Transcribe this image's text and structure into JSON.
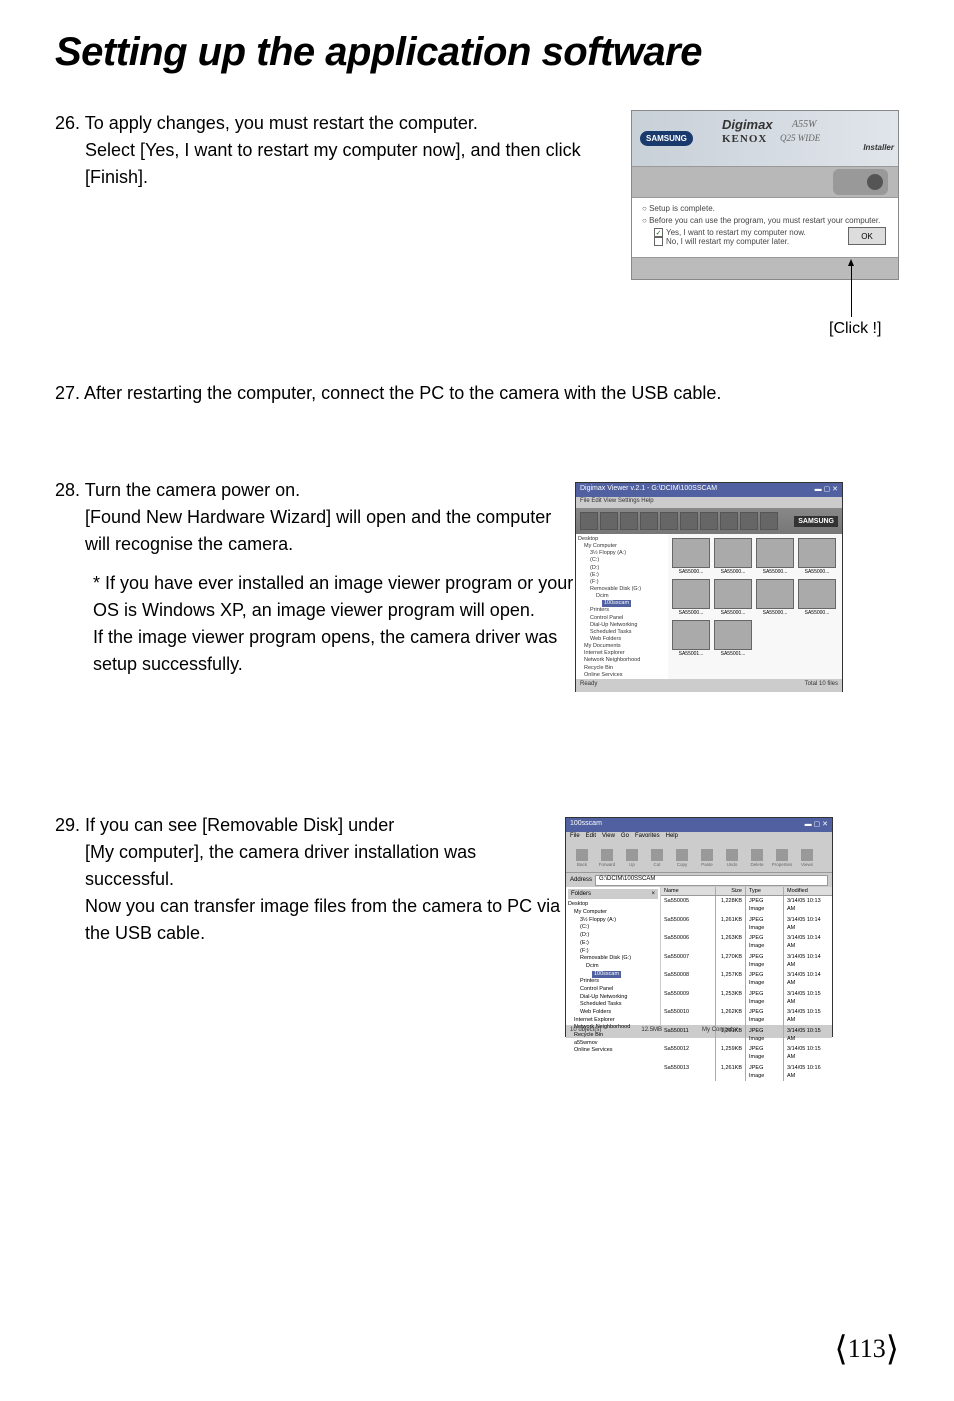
{
  "title": "Setting up the application software",
  "step26": {
    "num": "26.",
    "text1": "To apply changes, you must restart the computer.",
    "text2": "Select [Yes, I want to restart my computer now], and then click [Finish].",
    "clickLabel": "[Click !]"
  },
  "installer": {
    "samsung": "SAMSUNG",
    "digimax": "Digimax",
    "model": "A55W",
    "kenox": "KENOX",
    "q25": "Q25 WIDE",
    "installerText": "Installer",
    "setup": "Setup is complete.",
    "before": "Before you can use the program, you must restart your computer.",
    "yesRestart": "Yes, I want to restart my computer now.",
    "noRestart": "No, I will restart my computer later.",
    "ok": "OK"
  },
  "step27": {
    "num": "27.",
    "text": "After restarting the computer, connect the PC to the camera with the USB cable."
  },
  "step28": {
    "num": "28.",
    "text1": "Turn the camera power on.",
    "text2": "[Found New Hardware Wizard] will open and the computer will recognise the camera.",
    "sub1": "* If you have ever installed an image viewer program or your OS is Windows XP, an image viewer program will open.",
    "sub2": "If the image viewer program opens, the camera driver was setup successfully."
  },
  "viewer": {
    "title": "Digimax Viewer v.2.1 - G:\\DCIM\\100SSCAM",
    "menus": "File  Edit  View  Settings  Help",
    "samsung": "SAMSUNG",
    "tree": {
      "desktop": "Desktop",
      "mycomputer": "My Computer",
      "floppy": "3½ Floppy (A:)",
      "c": "(C:)",
      "d": "(D:)",
      "e": "(E:)",
      "f": "(F:)",
      "removable": "Removable Disk (G:)",
      "dcim": "Dcim",
      "sscam": "100sscam",
      "printers": "Printers",
      "control": "Control Panel",
      "dialup": "Dial-Up Networking",
      "scheduled": "Scheduled Tasks",
      "webfolders": "Web Folders",
      "mydocs": "My Documents",
      "ie": "Internet Explorer",
      "network": "Network Neighborhood",
      "recycle": "Recycle Bin",
      "online": "Online Services"
    },
    "thumbs": [
      "SA55000...",
      "SA55000...",
      "SA55000...",
      "SA55000...",
      "SA55000...",
      "SA55000...",
      "SA55000...",
      "SA55000...",
      "SA55001...",
      "SA55001..."
    ],
    "ready": "Ready",
    "total": "Total 10 files"
  },
  "step29": {
    "num": "29.",
    "text1": "If you can see [Removable Disk] under",
    "text2": "[My computer], the camera driver installation was successful.",
    "text3": "Now you can transfer image files from the camera to PC via the USB cable."
  },
  "explorer": {
    "title": "100sscam",
    "menus": [
      "File",
      "Edit",
      "View",
      "Go",
      "Favorites",
      "Help"
    ],
    "toolbarBtns": [
      "Back",
      "Forward",
      "Up",
      "Cut",
      "Copy",
      "Paste",
      "Undo",
      "Delete",
      "Properties",
      "Views"
    ],
    "addressLabel": "Address",
    "addressValue": "G:\\DCIM\\100SSCAM",
    "foldersLabel": "Folders",
    "tree": {
      "desktop": "Desktop",
      "mycomputer": "My Computer",
      "floppy": "3½ Floppy (A:)",
      "c": "(C:)",
      "d": "(D:)",
      "e": "(E:)",
      "f": "(F:)",
      "removable": "Removable Disk (G:)",
      "dcim": "Dcim",
      "sscam": "100sscam",
      "printers": "Printers",
      "control": "Control Panel",
      "dialup": "Dial-Up Networking",
      "scheduled": "Scheduled Tasks",
      "webfolders": "Web Folders",
      "ie": "Internet Explorer",
      "network": "Network Neighborhood",
      "recycle": "Recycle Bin",
      "a55wmov": "a55wmov",
      "online": "Online Services"
    },
    "listHeaders": {
      "name": "Name",
      "size": "Size",
      "type": "Type",
      "modified": "Modified"
    },
    "files": [
      {
        "name": "Sa550005",
        "size": "1,228KB",
        "type": "JPEG Image",
        "mod": "3/14/05 10:13 AM"
      },
      {
        "name": "Sa550006",
        "size": "1,261KB",
        "type": "JPEG Image",
        "mod": "3/14/05 10:14 AM"
      },
      {
        "name": "Sa550006",
        "size": "1,263KB",
        "type": "JPEG Image",
        "mod": "3/14/05 10:14 AM"
      },
      {
        "name": "Sa550007",
        "size": "1,270KB",
        "type": "JPEG Image",
        "mod": "3/14/05 10:14 AM"
      },
      {
        "name": "Sa550008",
        "size": "1,257KB",
        "type": "JPEG Image",
        "mod": "3/14/05 10:14 AM"
      },
      {
        "name": "Sa550009",
        "size": "1,253KB",
        "type": "JPEG Image",
        "mod": "3/14/05 10:15 AM"
      },
      {
        "name": "Sa550010",
        "size": "1,262KB",
        "type": "JPEG Image",
        "mod": "3/14/05 10:15 AM"
      },
      {
        "name": "Sa550011",
        "size": "1,261KB",
        "type": "JPEG Image",
        "mod": "3/14/05 10:15 AM"
      },
      {
        "name": "Sa550012",
        "size": "1,259KB",
        "type": "JPEG Image",
        "mod": "3/14/05 10:15 AM"
      },
      {
        "name": "Sa550013",
        "size": "1,261KB",
        "type": "JPEG Image",
        "mod": "3/14/05 10:16 AM"
      }
    ],
    "statusObjects": "10 object(s)",
    "statusSize": "12.5MB",
    "statusLocation": "My Computer"
  },
  "pageNumber": "113"
}
